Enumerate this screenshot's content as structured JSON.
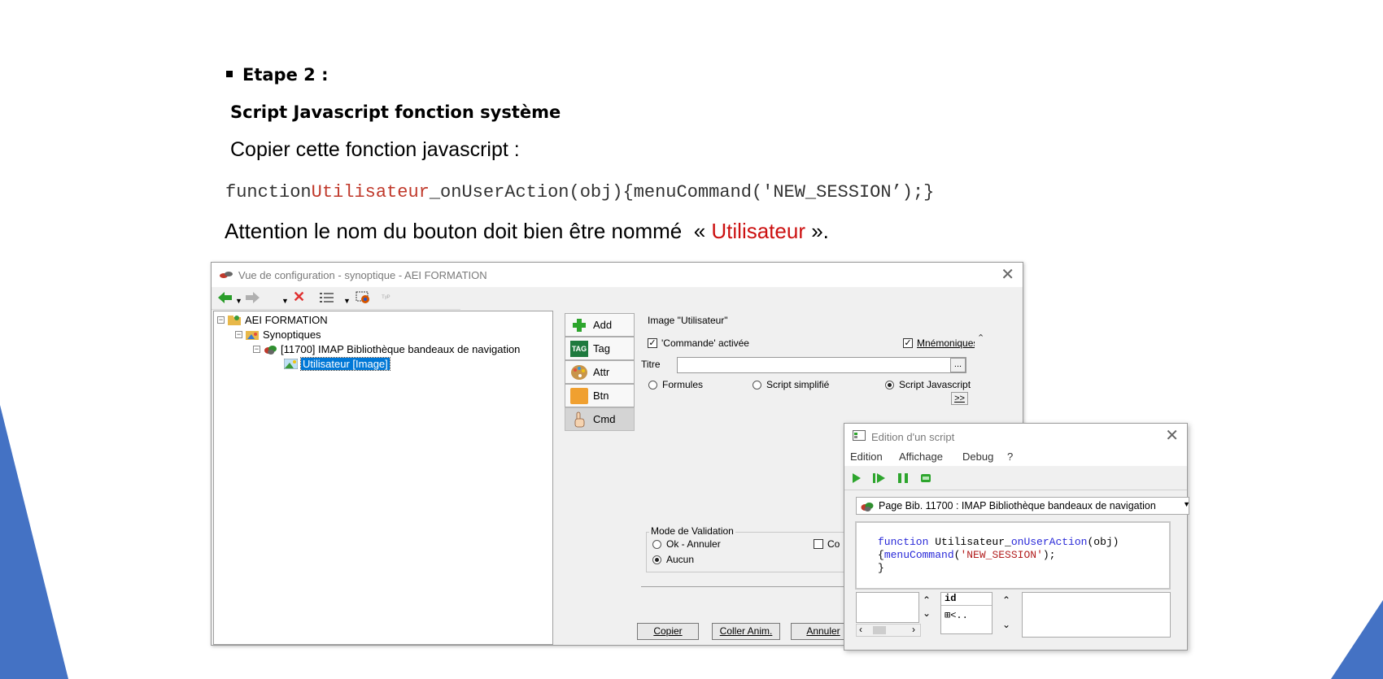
{
  "slide": {
    "step": "Etape 2 :",
    "subtitle": "Script Javascript fonction système",
    "copy_instruction": "Copier cette fonction javascript :",
    "code": {
      "prefix": "function",
      "name": "Utilisateur",
      "suffix": "_onUserAction(obj){menuCommand('NEW_SESSION’);}"
    },
    "attention": {
      "before": "Attention le nom du bouton doit bien être nommé  « ",
      "name": "Utilisateur",
      "after": " »."
    },
    "accent_color": "#4472c4"
  },
  "config_window": {
    "title": "Vue de configuration - synoptique - AEI FORMATION",
    "close": "✕",
    "tree": {
      "root": "AEI FORMATION",
      "synoptiques": "Synoptiques",
      "page": "[11700]  IMAP Bibliothèque bandeaux de navigation",
      "selected": "Utilisateur [Image]"
    },
    "side_buttons": [
      "Add",
      "Tag",
      "Attr",
      "Btn",
      "Cmd"
    ],
    "tag_icon_text": "TAG",
    "panel": {
      "image_label": "Image  \"Utilisateur\"",
      "commande_activee": "'Commande' activée",
      "mnemoniques": "Mnémoniques",
      "titre_label": "Titre",
      "titre_value": "",
      "ellipsis": "...",
      "radio_formules": "Formules",
      "radio_script_simplifie": "Script simplifié",
      "radio_script_javascript": "Script Javascript",
      "more": ">>",
      "mode_validation": "Mode de Validation",
      "ok_annuler": "Ok - Annuler",
      "aucun": "Aucun",
      "co": "Co"
    },
    "bottom_buttons": [
      "Copier",
      "Coller Anim.",
      "Annuler"
    ]
  },
  "script_window": {
    "title": "Edition d'un script",
    "close": "✕",
    "menu": [
      "Edition",
      "Affichage",
      "Debug",
      "?"
    ],
    "page_combo": "Page Bib. 11700 : IMAP Bibliothèque bandeaux de navigation",
    "code_line1": {
      "kw": "function",
      "name": " Utilisateur_",
      "fn": "onUserAction",
      "rest": "(obj)"
    },
    "code_line2": {
      "open": "{",
      "fn": "menuCommand",
      "p1": "(",
      "str": "'NEW_SESSION'",
      "p2": ");"
    },
    "code_line3": "}",
    "watch_header": "id",
    "watch_row": "⊞<.."
  }
}
